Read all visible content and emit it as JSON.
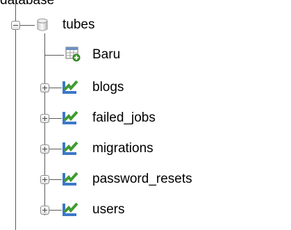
{
  "header": {
    "clipped_label": "database"
  },
  "tree": {
    "database": {
      "name": "tubes",
      "icon": "database-icon"
    },
    "new_item": {
      "label": "Baru",
      "icon": "new-table-icon"
    },
    "tables": [
      {
        "name": "blogs",
        "icon": "table-icon"
      },
      {
        "name": "failed_jobs",
        "icon": "table-icon"
      },
      {
        "name": "migrations",
        "icon": "table-icon"
      },
      {
        "name": "password_resets",
        "icon": "table-icon"
      },
      {
        "name": "users",
        "icon": "table-icon"
      }
    ]
  },
  "colors": {
    "tree_line": "#595959",
    "table_icon_green": "#3f9b2f",
    "table_icon_blue": "#3c78c8"
  }
}
